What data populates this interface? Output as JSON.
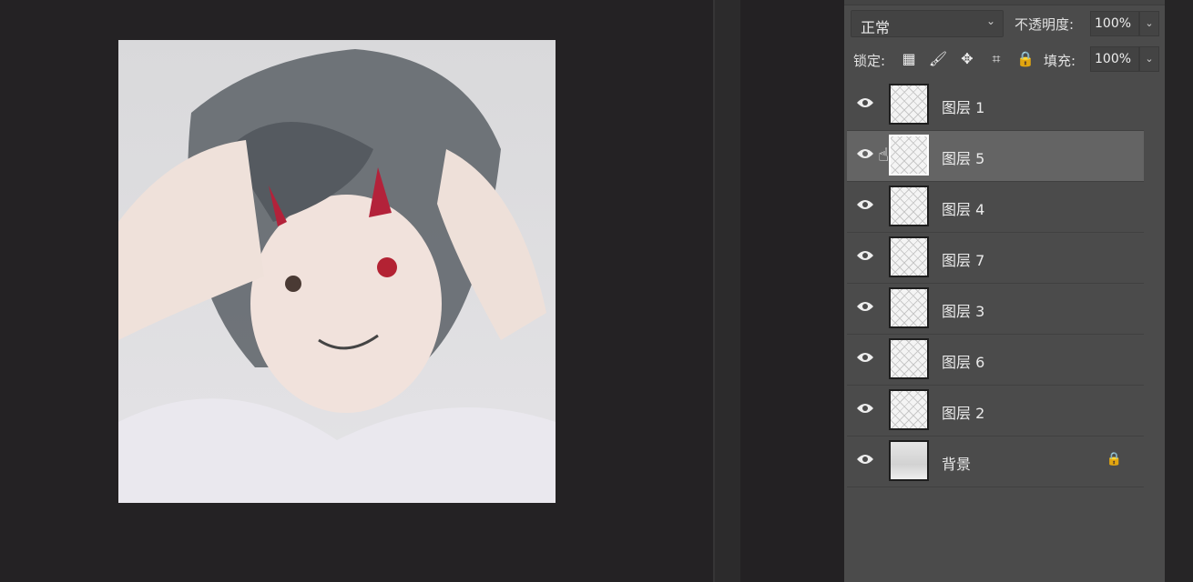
{
  "toolbar": {
    "blend_mode": "正常",
    "opacity_label": "不透明度:",
    "opacity_value": "100%",
    "lock_label": "锁定:",
    "fill_label": "填充:",
    "fill_value": "100%"
  },
  "layers": [
    {
      "name": "图层 1",
      "visible": true,
      "selected": false
    },
    {
      "name": "图层 5",
      "visible": true,
      "selected": true
    },
    {
      "name": "图层 4",
      "visible": true,
      "selected": false
    },
    {
      "name": "图层 7",
      "visible": true,
      "selected": false
    },
    {
      "name": "图层 3",
      "visible": true,
      "selected": false
    },
    {
      "name": "图层 6",
      "visible": true,
      "selected": false
    },
    {
      "name": "图层 2",
      "visible": true,
      "selected": false
    },
    {
      "name": "背景",
      "visible": true,
      "selected": false,
      "locked": true
    }
  ]
}
